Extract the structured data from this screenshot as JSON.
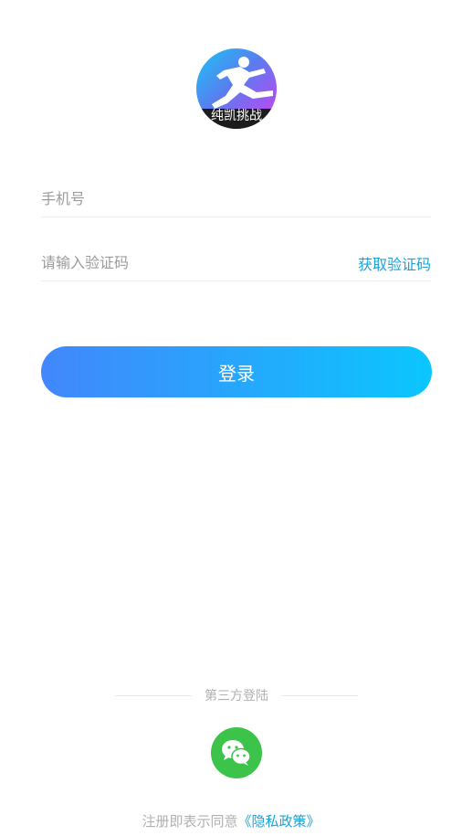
{
  "logo": {
    "caption": "纯凯挑战"
  },
  "form": {
    "phone_placeholder": "手机号",
    "code_placeholder": "请输入验证码",
    "get_code_label": "获取验证码",
    "login_label": "登录"
  },
  "third_party": {
    "divider_label": "第三方登陆",
    "wechat_icon": "wechat-icon"
  },
  "agreement": {
    "text": "注册即表示同意",
    "policy_link": "《隐私政策》"
  },
  "colors": {
    "accent": "#1aa3d8",
    "button_gradient_start": "#4287fc",
    "button_gradient_end": "#0bc6fd",
    "wechat_green": "#3cc34a"
  }
}
